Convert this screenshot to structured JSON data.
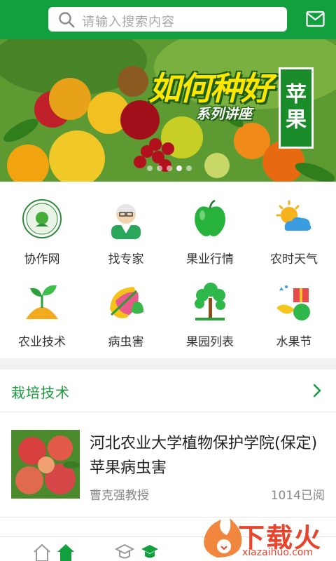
{
  "header": {
    "search_placeholder": "请输入搜索内容",
    "search_icon": "search-icon",
    "mail_icon": "mail-icon"
  },
  "banner": {
    "title": "如何种好",
    "subtitle": "系列讲座",
    "fruit_label": "苹果",
    "slide_count": 5,
    "active_slide": 3
  },
  "grid": {
    "items": [
      {
        "label": "协作网",
        "icon": "network-logo-icon"
      },
      {
        "label": "找专家",
        "icon": "expert-icon"
      },
      {
        "label": "果业行情",
        "icon": "apple-icon"
      },
      {
        "label": "农时天气",
        "icon": "weather-icon"
      },
      {
        "label": "农业技术",
        "icon": "sprout-icon"
      },
      {
        "label": "病虫害",
        "icon": "leaf-pest-icon"
      },
      {
        "label": "果园列表",
        "icon": "orchard-tree-icon"
      },
      {
        "label": "水果节",
        "icon": "fruit-gift-icon"
      }
    ]
  },
  "section": {
    "title": "栽培技术",
    "articles": [
      {
        "title": "河北农业大学植物保护学院(保定)苹果病虫害",
        "author": "曹克强教授",
        "views": "1014已阅"
      }
    ]
  },
  "watermark": {
    "text": "下载火",
    "url": "xiazaihuo.com"
  },
  "colors": {
    "primary": "#12a03e",
    "section_title": "#1c9a40",
    "watermark": "#e8442c"
  }
}
